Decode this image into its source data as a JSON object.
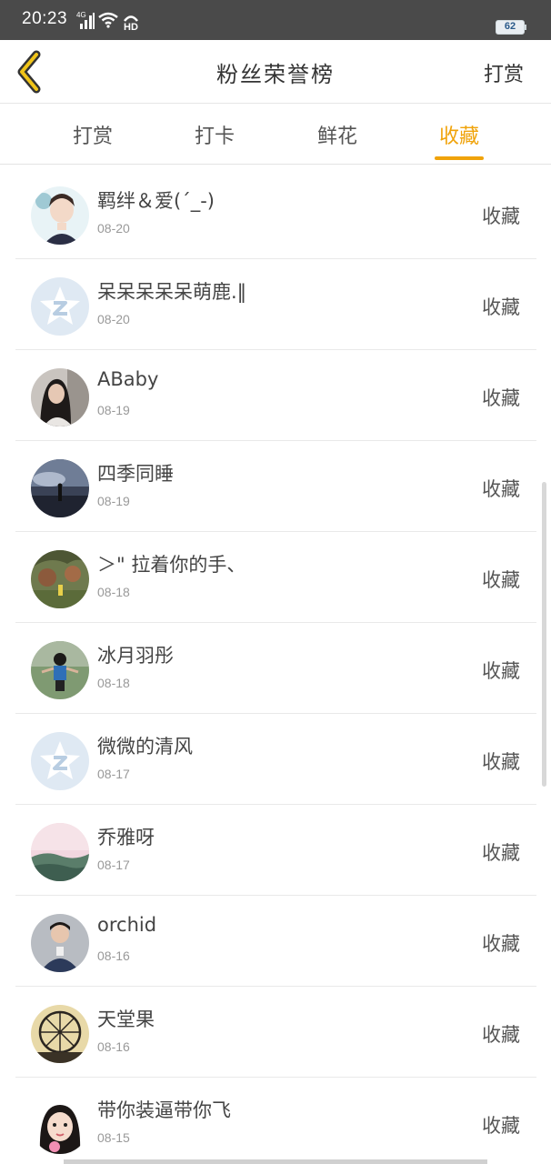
{
  "status_bar": {
    "time": "20:23",
    "network": "4G",
    "hd_label": "HD",
    "battery": "62"
  },
  "header": {
    "title": "粉丝荣誉榜",
    "action_label": "打赏",
    "back_icon": "chevron-left-icon",
    "accent_color": "#f0a30a"
  },
  "tabs": [
    {
      "label": "打赏",
      "active": false
    },
    {
      "label": "打卡",
      "active": false
    },
    {
      "label": "鲜花",
      "active": false
    },
    {
      "label": "收藏",
      "active": true
    }
  ],
  "rows": [
    {
      "name": "羁绊＆爱(ˊ_-)",
      "date": "08-20",
      "action": "收藏",
      "avatar": "cartoon-portrait"
    },
    {
      "name": "呆呆呆呆呆萌鹿.‖",
      "date": "08-20",
      "action": "收藏",
      "avatar": "default-qq-avatar"
    },
    {
      "name": "ABaby",
      "date": "08-19",
      "action": "收藏",
      "avatar": "woman-photo"
    },
    {
      "name": "四季同睡",
      "date": "08-19",
      "action": "收藏",
      "avatar": "sky-silhouette"
    },
    {
      "name": "＞\" 拉着你的手、",
      "date": "08-18",
      "action": "收藏",
      "avatar": "garden-photo"
    },
    {
      "name": "冰月羽彤",
      "date": "08-18",
      "action": "收藏",
      "avatar": "woman-outdoor"
    },
    {
      "name": "微微的清风",
      "date": "08-17",
      "action": "收藏",
      "avatar": "default-qq-avatar"
    },
    {
      "name": "乔雅呀",
      "date": "08-17",
      "action": "收藏",
      "avatar": "sunset-landscape"
    },
    {
      "name": "orchid",
      "date": "08-16",
      "action": "收藏",
      "avatar": "man-photo"
    },
    {
      "name": "天堂果",
      "date": "08-16",
      "action": "收藏",
      "avatar": "ferris-wheel"
    },
    {
      "name": "带你装逼带你飞",
      "date": "08-15",
      "action": "收藏",
      "avatar": "cartoon-girl"
    }
  ]
}
